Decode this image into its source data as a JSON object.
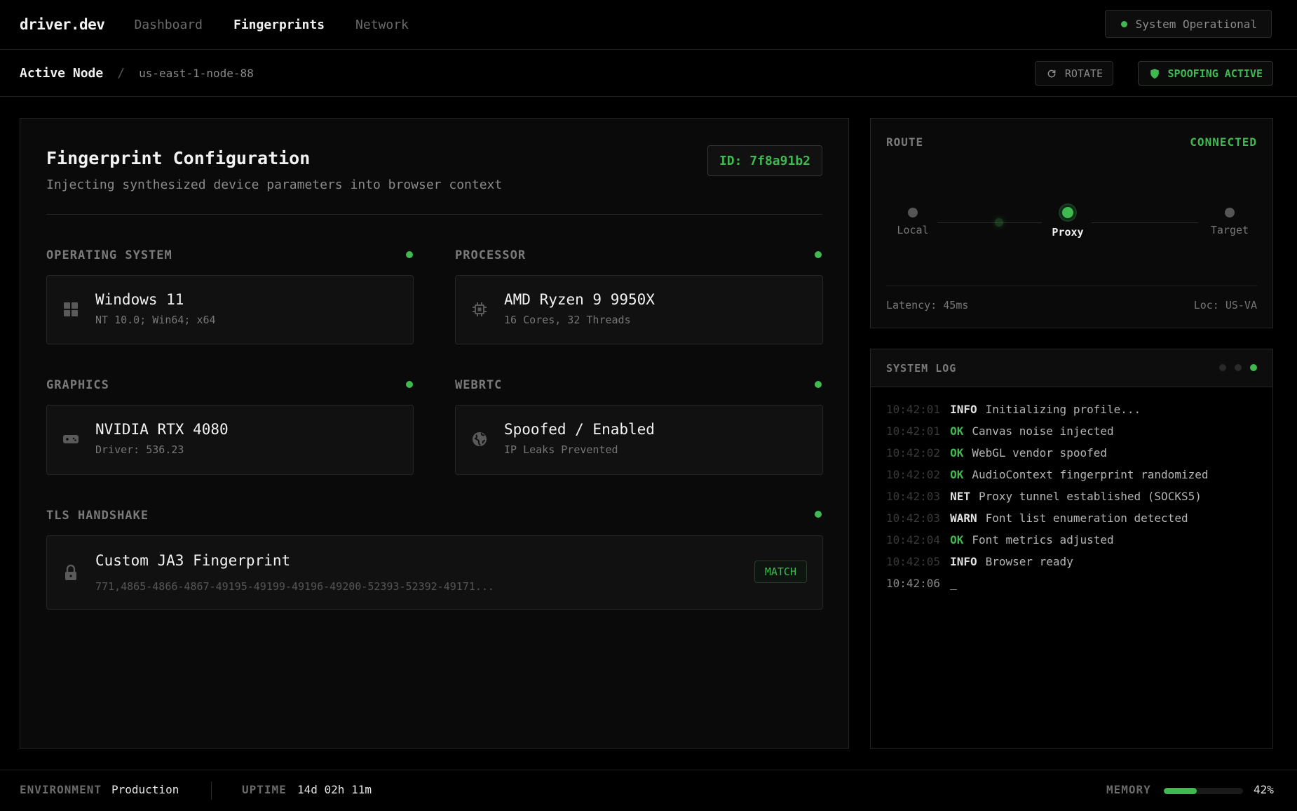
{
  "brand": "driver.dev",
  "nav": [
    {
      "label": "Dashboard",
      "active": false
    },
    {
      "label": "Fingerprints",
      "active": true
    },
    {
      "label": "Network",
      "active": false
    }
  ],
  "system_status": "System Operational",
  "breadcrumb": {
    "root": "Active Node",
    "separator": "/",
    "node": "us-east-1-node-88"
  },
  "actions": {
    "rotate_label": "ROTATE",
    "spoofing_label": "SPOOFING ACTIVE"
  },
  "config": {
    "title": "Fingerprint Configuration",
    "subtitle": "Injecting synthesized device parameters into browser context",
    "id_label": "ID: 7f8a91b2",
    "sections": {
      "os": {
        "label": "OPERATING SYSTEM",
        "title": "Windows 11",
        "sub": "NT 10.0; Win64; x64",
        "icon": "windows-icon"
      },
      "cpu": {
        "label": "PROCESSOR",
        "title": "AMD Ryzen 9 9950X",
        "sub": "16 Cores, 32 Threads",
        "icon": "cpu-icon"
      },
      "gpu": {
        "label": "GRAPHICS",
        "title": "NVIDIA RTX 4080",
        "sub": "Driver: 536.23",
        "icon": "gamepad-icon"
      },
      "webrtc": {
        "label": "WEBRTC",
        "title": "Spoofed / Enabled",
        "sub": "IP Leaks Prevented",
        "icon": "globe-icon"
      },
      "tls": {
        "label": "TLS HANDSHAKE",
        "title": "Custom JA3 Fingerprint",
        "sub": "771,4865-4866-4867-49195-49199-49196-49200-52393-52392-49171...",
        "badge": "MATCH",
        "icon": "lock-icon"
      }
    }
  },
  "route": {
    "label": "ROUTE",
    "status": "CONNECTED",
    "nodes": [
      {
        "label": "Local",
        "active": false
      },
      {
        "label": "Proxy",
        "active": true
      },
      {
        "label": "Target",
        "active": false
      }
    ],
    "latency": "Latency: 45ms",
    "location": "Loc: US-VA"
  },
  "system_log": {
    "title": "SYSTEM LOG",
    "entries": [
      {
        "time": "10:42:01",
        "level": "INFO",
        "message": "Initializing profile..."
      },
      {
        "time": "10:42:01",
        "level": "OK",
        "message": "Canvas noise injected"
      },
      {
        "time": "10:42:02",
        "level": "OK",
        "message": "WebGL vendor spoofed"
      },
      {
        "time": "10:42:02",
        "level": "OK",
        "message": "AudioContext fingerprint randomized"
      },
      {
        "time": "10:42:03",
        "level": "NET",
        "message": "Proxy tunnel established (SOCKS5)"
      },
      {
        "time": "10:42:03",
        "level": "WARN",
        "message": "Font list enumeration detected"
      },
      {
        "time": "10:42:04",
        "level": "OK",
        "message": "Font metrics adjusted"
      },
      {
        "time": "10:42:05",
        "level": "INFO",
        "message": "Browser ready"
      }
    ],
    "current_time": "10:42:06",
    "cursor": "_"
  },
  "footer": {
    "environment_label": "ENVIRONMENT",
    "environment_value": "Production",
    "uptime_label": "UPTIME",
    "uptime_value": "14d 02h 11m",
    "memory_label": "MEMORY",
    "memory_percent": 42,
    "memory_text": "42%"
  },
  "colors": {
    "accent": "#3fb950",
    "background": "#000000",
    "panel": "#0a0a0a",
    "border": "#262626"
  }
}
